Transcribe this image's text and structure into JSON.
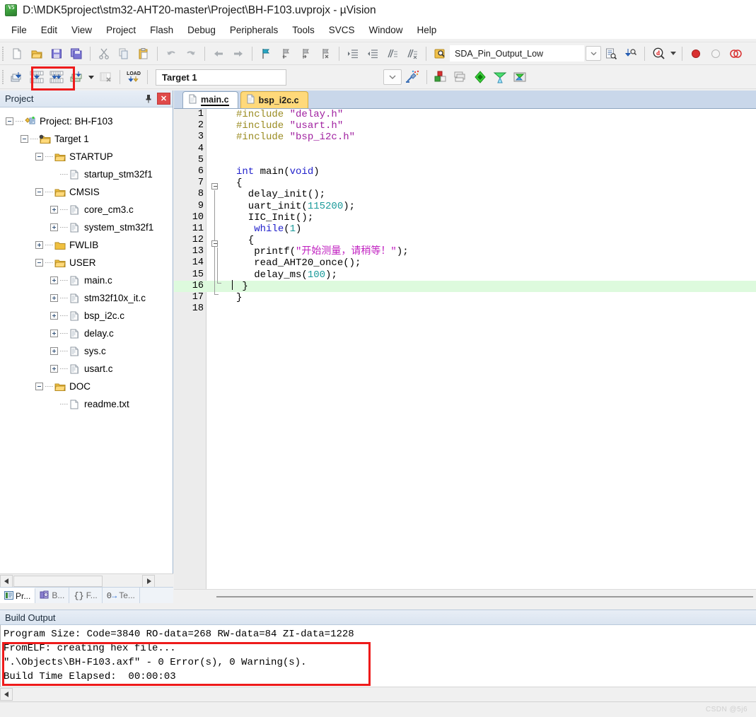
{
  "window": {
    "title": "D:\\MDK5project\\stm32-AHT20-master\\Project\\BH-F103.uvprojx - µVision",
    "app_icon": "uvision5-icon"
  },
  "menu": {
    "items": [
      "File",
      "Edit",
      "View",
      "Project",
      "Flash",
      "Debug",
      "Peripherals",
      "Tools",
      "SVCS",
      "Window",
      "Help"
    ]
  },
  "toolbar_main": {
    "find_value": "SDA_Pin_Output_Low",
    "icons": [
      "new-file-icon",
      "open-file-icon",
      "save-icon",
      "save-all-icon",
      "cut-icon",
      "copy-icon",
      "paste-icon",
      "undo-icon",
      "redo-icon",
      "navigate-back-icon",
      "navigate-forward-icon",
      "bookmark-toggle-icon",
      "bookmark-prev-icon",
      "bookmark-next-icon",
      "bookmark-clear-icon",
      "indent-icon",
      "outdent-icon",
      "comment-icon",
      "uncomment-icon",
      "find-in-files-icon",
      "find-next-icon",
      "incremental-find-icon",
      "debug-icon",
      "record-icon",
      "stop-icon",
      "analysis-icon"
    ]
  },
  "toolbar_build": {
    "target_value": "Target 1",
    "icons": [
      "translate-icon",
      "build-icon",
      "rebuild-icon",
      "batch-build-icon",
      "stop-build-icon",
      "download-icon",
      "target-options-icon",
      "manage-runtime-icon",
      "multi-project-icon",
      "configuration-icon",
      "pack-installer-icon",
      "manage-components-icon"
    ],
    "annotation": "red-highlight-build-buttons"
  },
  "project_panel": {
    "title": "Project",
    "pin_icon": "pin-icon",
    "close_icon": "close-icon",
    "tree": [
      {
        "label": "Project: BH-F103",
        "indent": 0,
        "expander": "minus",
        "icon": "project-icon"
      },
      {
        "label": "Target 1",
        "indent": 1,
        "expander": "minus",
        "icon": "target-folder-icon"
      },
      {
        "label": "STARTUP",
        "indent": 2,
        "expander": "minus",
        "icon": "folder-open-icon"
      },
      {
        "label": "startup_stm32f1",
        "indent": 3,
        "expander": "none",
        "icon": "file-icon"
      },
      {
        "label": "CMSIS",
        "indent": 2,
        "expander": "minus",
        "icon": "folder-open-icon"
      },
      {
        "label": "core_cm3.c",
        "indent": 3,
        "expander": "plus",
        "icon": "c-file-icon"
      },
      {
        "label": "system_stm32f1",
        "indent": 3,
        "expander": "plus",
        "icon": "c-file-icon"
      },
      {
        "label": "FWLIB",
        "indent": 2,
        "expander": "plus",
        "icon": "folder-closed-icon"
      },
      {
        "label": "USER",
        "indent": 2,
        "expander": "minus",
        "icon": "folder-open-icon"
      },
      {
        "label": "main.c",
        "indent": 3,
        "expander": "plus",
        "icon": "c-file-icon"
      },
      {
        "label": "stm32f10x_it.c",
        "indent": 3,
        "expander": "plus",
        "icon": "c-file-icon"
      },
      {
        "label": "bsp_i2c.c",
        "indent": 3,
        "expander": "plus",
        "icon": "c-file-icon"
      },
      {
        "label": "delay.c",
        "indent": 3,
        "expander": "plus",
        "icon": "c-file-icon"
      },
      {
        "label": "sys.c",
        "indent": 3,
        "expander": "plus",
        "icon": "c-file-icon"
      },
      {
        "label": "usart.c",
        "indent": 3,
        "expander": "plus",
        "icon": "c-file-icon"
      },
      {
        "label": "DOC",
        "indent": 2,
        "expander": "minus",
        "icon": "folder-open-icon"
      },
      {
        "label": "readme.txt",
        "indent": 3,
        "expander": "none",
        "icon": "txt-file-icon"
      }
    ],
    "bottom_tabs": [
      {
        "label": "Pr...",
        "icon": "project-tab-icon",
        "active": true
      },
      {
        "label": "B...",
        "icon": "books-tab-icon",
        "active": false
      },
      {
        "label": "F...",
        "icon": "functions-tab-icon",
        "active": false
      },
      {
        "label": "Te...",
        "icon": "templates-tab-icon",
        "active": false
      }
    ]
  },
  "editor": {
    "tabs": [
      {
        "label": "main.c",
        "active": true,
        "icon": "file-icon"
      },
      {
        "label": "bsp_i2c.c",
        "active": false,
        "icon": "file-icon"
      }
    ],
    "current_line": 16,
    "lines": [
      {
        "n": 1,
        "segments": [
          {
            "t": "#include ",
            "c": "pre"
          },
          {
            "t": "\"delay.h\"",
            "c": "str"
          }
        ]
      },
      {
        "n": 2,
        "segments": [
          {
            "t": "#include ",
            "c": "pre"
          },
          {
            "t": "\"usart.h\"",
            "c": "str"
          }
        ]
      },
      {
        "n": 3,
        "segments": [
          {
            "t": "#include ",
            "c": "pre"
          },
          {
            "t": "\"bsp_i2c.h\"",
            "c": "str"
          }
        ]
      },
      {
        "n": 4,
        "segments": []
      },
      {
        "n": 5,
        "segments": []
      },
      {
        "n": 6,
        "segments": [
          {
            "t": "int ",
            "c": "kw"
          },
          {
            "t": "main(",
            "c": ""
          },
          {
            "t": "void",
            "c": "kw"
          },
          {
            "t": ")",
            "c": ""
          }
        ]
      },
      {
        "n": 7,
        "segments": [
          {
            "t": "{",
            "c": ""
          }
        ]
      },
      {
        "n": 8,
        "segments": [
          {
            "t": "  delay_init();",
            "c": ""
          }
        ]
      },
      {
        "n": 9,
        "segments": [
          {
            "t": "  uart_init(",
            "c": ""
          },
          {
            "t": "115200",
            "c": "num"
          },
          {
            "t": ");",
            "c": ""
          }
        ]
      },
      {
        "n": 10,
        "segments": [
          {
            "t": "  IIC_Init();",
            "c": ""
          }
        ]
      },
      {
        "n": 11,
        "segments": [
          {
            "t": "   ",
            "c": ""
          },
          {
            "t": "while",
            "c": "kw"
          },
          {
            "t": "(",
            "c": ""
          },
          {
            "t": "1",
            "c": "num"
          },
          {
            "t": ")",
            "c": ""
          }
        ]
      },
      {
        "n": 12,
        "segments": [
          {
            "t": "  {",
            "c": ""
          }
        ]
      },
      {
        "n": 13,
        "segments": [
          {
            "t": "   printf(",
            "c": ""
          },
          {
            "t": "\"开始测量，请稍等！\"",
            "c": "cn"
          },
          {
            "t": ");",
            "c": ""
          }
        ]
      },
      {
        "n": 14,
        "segments": [
          {
            "t": "   read_AHT20_once();",
            "c": ""
          }
        ]
      },
      {
        "n": 15,
        "segments": [
          {
            "t": "   delay_ms(",
            "c": ""
          },
          {
            "t": "100",
            "c": "num"
          },
          {
            "t": ");",
            "c": ""
          }
        ]
      },
      {
        "n": 16,
        "segments": [
          {
            "t": " }",
            "c": ""
          }
        ]
      },
      {
        "n": 17,
        "segments": [
          {
            "t": "}",
            "c": ""
          }
        ]
      },
      {
        "n": 18,
        "segments": []
      }
    ]
  },
  "build_output": {
    "title": "Build Output",
    "lines": [
      "Program Size: Code=3840 RO-data=268 RW-data=84 ZI-data=1228",
      "FromELF: creating hex file...",
      "\".\\Objects\\BH-F103.axf\" - 0 Error(s), 0 Warning(s).",
      "Build Time Elapsed:  00:00:03"
    ],
    "annotation": "red-highlight-build-result"
  },
  "status_bar": {
    "watermark": "CSDN @5j6"
  },
  "colors": {
    "annotation_red": "#ee1b1b",
    "tab_active": "#ffffff",
    "tab_inactive": "#ffd97a",
    "current_line_highlight": "#ddfadd",
    "preprocessor": "#9a8b20",
    "string": "#a020a0",
    "keyword": "#2222cc",
    "number": "#1a9a9a"
  }
}
